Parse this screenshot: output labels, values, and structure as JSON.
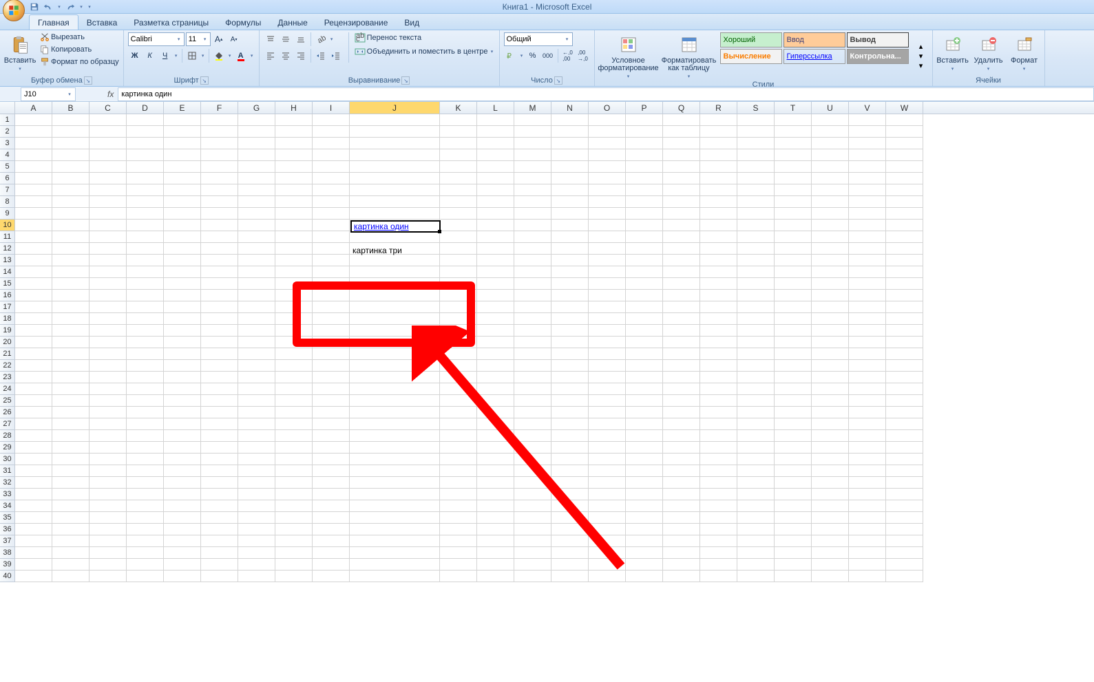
{
  "title": "Книга1 - Microsoft Excel",
  "tabs": [
    "Главная",
    "Вставка",
    "Разметка страницы",
    "Формулы",
    "Данные",
    "Рецензирование",
    "Вид"
  ],
  "clipboard": {
    "paste": "Вставить",
    "cut": "Вырезать",
    "copy": "Копировать",
    "format": "Формат по образцу",
    "label": "Буфер обмена"
  },
  "font": {
    "name": "Calibri",
    "size": "11",
    "label": "Шрифт"
  },
  "align": {
    "wrap": "Перенос текста",
    "merge": "Объединить и поместить в центре",
    "label": "Выравнивание"
  },
  "number": {
    "format": "Общий",
    "label": "Число"
  },
  "cond": {
    "cond": "Условное форматирование",
    "as_table": "Форматировать как таблицу"
  },
  "styles": {
    "good": "Хороший",
    "input": "Ввод",
    "output": "Вывод",
    "calc": "Вычисление",
    "link": "Гиперссылка",
    "check": "Контрольна...",
    "label": "Стили"
  },
  "cells": {
    "insert": "Вставить",
    "delete": "Удалить",
    "format": "Формат",
    "label": "Ячейки"
  },
  "namebox": "J10",
  "formula": "картинка один",
  "columns": [
    "A",
    "B",
    "C",
    "D",
    "E",
    "F",
    "G",
    "H",
    "I",
    "J",
    "K",
    "L",
    "M",
    "N",
    "O",
    "P",
    "Q",
    "R",
    "S",
    "T",
    "U",
    "V",
    "W"
  ],
  "rowcount": 40,
  "selected_row": 10,
  "selected_col": "J",
  "cell_j10": "картинка один",
  "cell_j12": "картинка три"
}
